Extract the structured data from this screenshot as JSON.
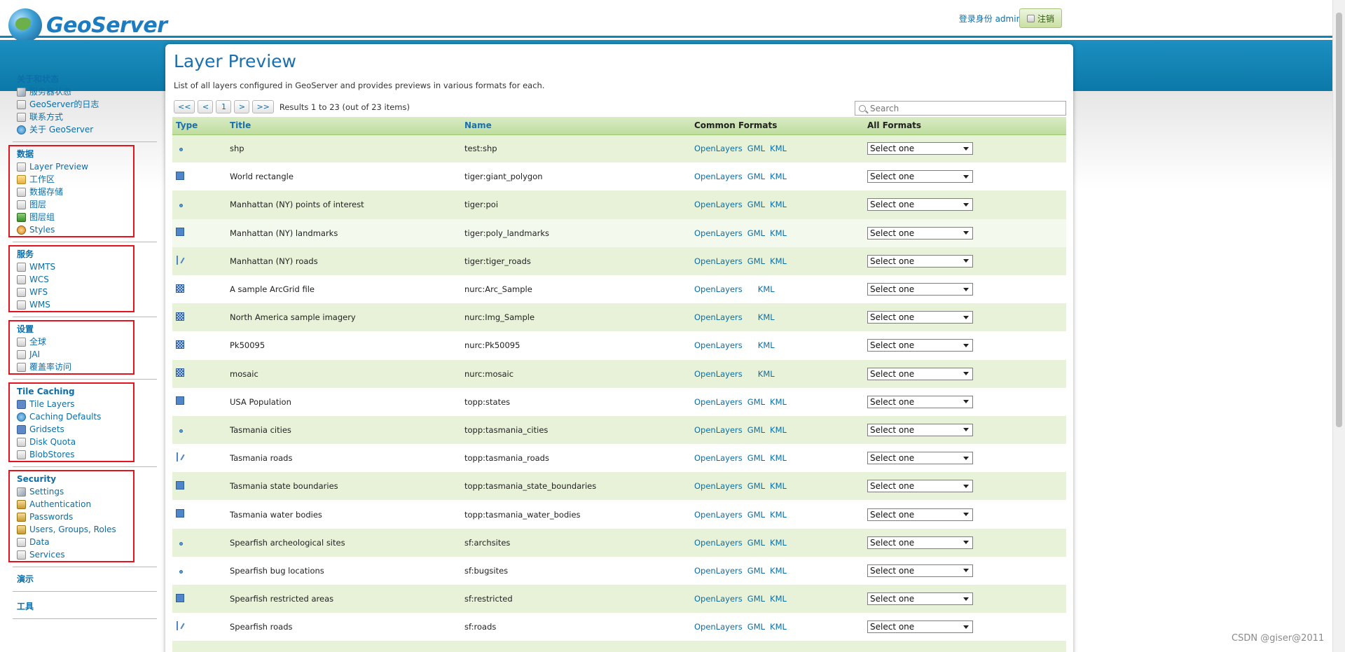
{
  "header": {
    "logo_text": "GeoServer",
    "login_text": "登录身份 admin.",
    "logout_label": "注销"
  },
  "sidebar": {
    "groups": [
      {
        "title": "关于和状态",
        "items": [
          "服务器状态",
          "GeoServer的日志",
          "联系方式",
          "关于 GeoServer"
        ]
      },
      {
        "title": "数据",
        "items": [
          "Layer Preview",
          "工作区",
          "数据存储",
          "图层",
          "图层组",
          "Styles"
        ]
      },
      {
        "title": "服务",
        "items": [
          "WMTS",
          "WCS",
          "WFS",
          "WMS"
        ]
      },
      {
        "title": "设置",
        "items": [
          "全球",
          "JAI",
          "覆盖率访问"
        ]
      },
      {
        "title": "Tile Caching",
        "items": [
          "Tile Layers",
          "Caching Defaults",
          "Gridsets",
          "Disk Quota",
          "BlobStores"
        ]
      },
      {
        "title": "Security",
        "items": [
          "Settings",
          "Authentication",
          "Passwords",
          "Users, Groups, Roles",
          "Data",
          "Services"
        ]
      },
      {
        "title": "演示",
        "items": []
      },
      {
        "title": "工具",
        "items": []
      }
    ]
  },
  "main": {
    "title": "Layer Preview",
    "description": "List of all layers configured in GeoServer and provides previews in various formats for each.",
    "pager": {
      "first": "<<",
      "prev": "<",
      "page": "1",
      "next": ">",
      "last": ">>",
      "results": "Results 1 to 23 (out of 23 items)"
    },
    "search_placeholder": "Search",
    "columns": [
      "Type",
      "Title",
      "Name",
      "Common Formats",
      "All Formats"
    ],
    "format_links": {
      "openlayers": "OpenLayers",
      "gml": "GML",
      "kml": "KML"
    },
    "select_default": "Select one",
    "rows": [
      {
        "type": "point",
        "title": "shp",
        "name": "test:shp",
        "gml": true
      },
      {
        "type": "polygon",
        "title": "World rectangle",
        "name": "tiger:giant_polygon",
        "gml": true
      },
      {
        "type": "point",
        "title": "Manhattan (NY) points of interest",
        "name": "tiger:poi",
        "gml": true
      },
      {
        "type": "polygon",
        "title": "Manhattan (NY) landmarks",
        "name": "tiger:poly_landmarks",
        "gml": true
      },
      {
        "type": "line",
        "title": "Manhattan (NY) roads",
        "name": "tiger:tiger_roads",
        "gml": true
      },
      {
        "type": "raster",
        "title": "A sample ArcGrid file",
        "name": "nurc:Arc_Sample",
        "gml": false
      },
      {
        "type": "raster",
        "title": "North America sample imagery",
        "name": "nurc:Img_Sample",
        "gml": false
      },
      {
        "type": "raster",
        "title": "Pk50095",
        "name": "nurc:Pk50095",
        "gml": false
      },
      {
        "type": "raster",
        "title": "mosaic",
        "name": "nurc:mosaic",
        "gml": false
      },
      {
        "type": "polygon",
        "title": "USA Population",
        "name": "topp:states",
        "gml": true
      },
      {
        "type": "point",
        "title": "Tasmania cities",
        "name": "topp:tasmania_cities",
        "gml": true
      },
      {
        "type": "line",
        "title": "Tasmania roads",
        "name": "topp:tasmania_roads",
        "gml": true
      },
      {
        "type": "polygon",
        "title": "Tasmania state boundaries",
        "name": "topp:tasmania_state_boundaries",
        "gml": true
      },
      {
        "type": "polygon",
        "title": "Tasmania water bodies",
        "name": "topp:tasmania_water_bodies",
        "gml": true
      },
      {
        "type": "point",
        "title": "Spearfish archeological sites",
        "name": "sf:archsites",
        "gml": true
      },
      {
        "type": "point",
        "title": "Spearfish bug locations",
        "name": "sf:bugsites",
        "gml": true
      },
      {
        "type": "polygon",
        "title": "Spearfish restricted areas",
        "name": "sf:restricted",
        "gml": true
      },
      {
        "type": "line",
        "title": "Spearfish roads",
        "name": "sf:roads",
        "gml": true
      }
    ]
  },
  "watermark": "CSDN @giser@2011"
}
